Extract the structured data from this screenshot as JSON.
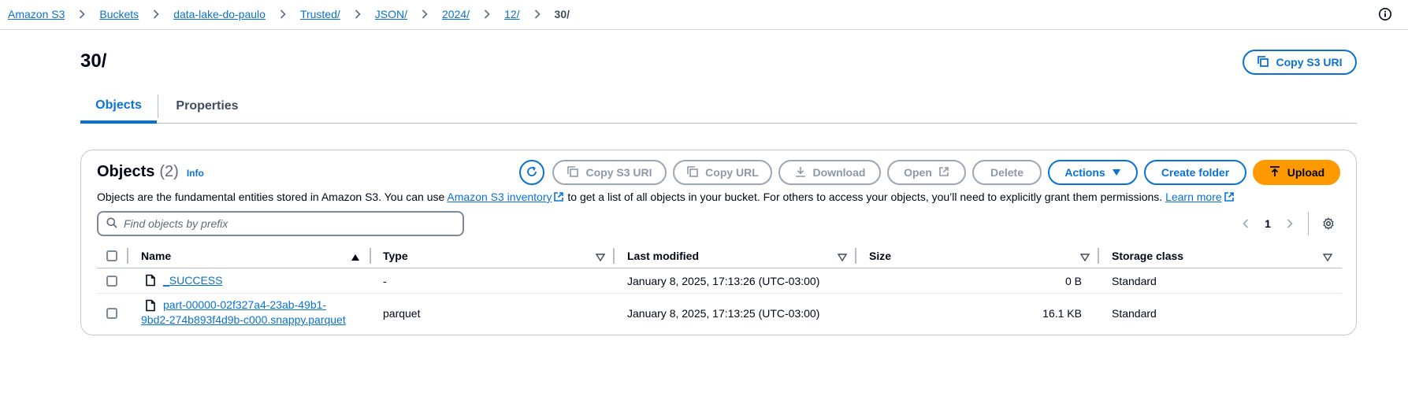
{
  "breadcrumb": [
    "Amazon S3",
    "Buckets",
    "data-lake-do-paulo",
    "Trusted/",
    "JSON/",
    "2024/",
    "12/"
  ],
  "breadcrumb_current": "30/",
  "page": {
    "title": "30/",
    "copy_uri_label": "Copy S3 URI"
  },
  "tabs": {
    "objects": "Objects",
    "properties": "Properties"
  },
  "objects_panel": {
    "title": "Objects",
    "count": "(2)",
    "info": "Info",
    "actions": {
      "copy_uri": "Copy S3 URI",
      "copy_url": "Copy URL",
      "download": "Download",
      "open": "Open",
      "delete": "Delete",
      "actions": "Actions",
      "create_folder": "Create folder",
      "upload": "Upload"
    },
    "desc_part1": "Objects are the fundamental entities stored in Amazon S3. You can use ",
    "desc_link1": "Amazon S3 inventory",
    "desc_part2": " to get a list of all objects in your bucket. For others to access your objects, you’ll need to explicitly grant them permissions. ",
    "desc_link2": "Learn more",
    "search_placeholder": "Find objects by prefix",
    "page_number": "1"
  },
  "table": {
    "columns": {
      "name": "Name",
      "type": "Type",
      "modified": "Last modified",
      "size": "Size",
      "storage": "Storage class"
    },
    "rows": [
      {
        "name_line1": "_SUCCESS",
        "name_line2": "",
        "type": "-",
        "modified": "January 8, 2025, 17:13:26 (UTC-03:00)",
        "size": "0 B",
        "storage": "Standard"
      },
      {
        "name_line1": "part-00000-02f327a4-23ab-49b1-",
        "name_line2": "9bd2-274b893f4d9b-c000.snappy.parquet",
        "type": "parquet",
        "modified": "January 8, 2025, 17:13:25 (UTC-03:00)",
        "size": "16.1 KB",
        "storage": "Standard"
      }
    ]
  }
}
